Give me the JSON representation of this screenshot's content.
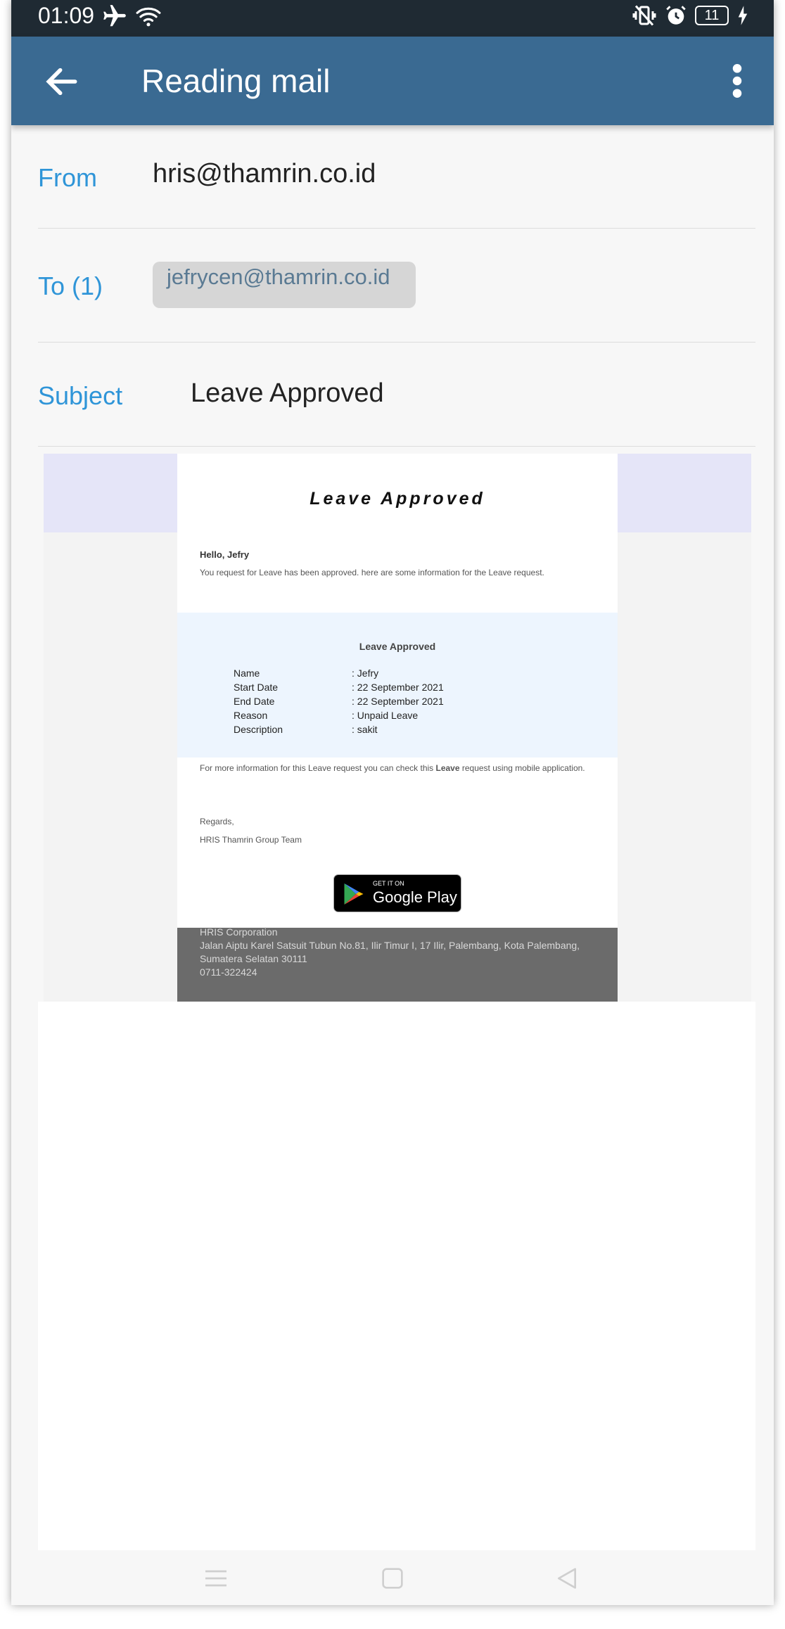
{
  "status_bar": {
    "time": "01:09",
    "battery": "11",
    "icons": [
      "airplane-icon",
      "wifi-icon",
      "vibrate-icon",
      "alarm-icon",
      "battery-icon",
      "charging-icon"
    ]
  },
  "app_bar": {
    "title": "Reading mail",
    "back_icon": "back-arrow-icon",
    "menu_icon": "more-vert-icon"
  },
  "mail": {
    "from_label": "From",
    "from_value": "hris@thamrin.co.id",
    "to_label": "To (1)",
    "to_chip": "jefrycen@thamrin.co.id",
    "subject_label": "Subject",
    "subject_value": "Leave Approved"
  },
  "email_body": {
    "heading": "Leave Approved",
    "greeting": "Hello, Jefry",
    "intro": "You request for Leave has been approved. here are some information for the Leave request.",
    "details_title": "Leave Approved",
    "details": [
      {
        "label": "Name",
        "value": ": Jefry"
      },
      {
        "label": "Start Date",
        "value": ": 22 September 2021"
      },
      {
        "label": "End Date",
        "value": ": 22 September 2021"
      },
      {
        "label": "Reason",
        "value": ": Unpaid Leave"
      },
      {
        "label": "Description",
        "value": ": sakit"
      }
    ],
    "more_info_before": "For more information for this Leave request you can check this ",
    "more_info_bold": "Leave",
    "more_info_after": " request using mobile application.",
    "regards": "Regards,",
    "team": "HRIS Thamrin Group Team",
    "gplay_small": "GET IT ON",
    "gplay_large": "Google Play",
    "footer": {
      "company": "HRIS Corporation",
      "address1": "Jalan Aiptu Karel Satsuit Tubun No.81, Ilir Timur I, 17 Ilir, Palembang, Kota Palembang,",
      "address2": "Sumatera Selatan 30111",
      "phone": "0711-322424"
    }
  },
  "nav_bar": {
    "icons": [
      "recents-icon",
      "home-icon",
      "back-nav-icon"
    ]
  },
  "colors": {
    "app_bar": "#3a6a92",
    "status_bar": "#1f2a33",
    "label_blue": "#2f95d8",
    "chip_bg": "#d6d6d6",
    "details_bg": "#edf5fe",
    "footer_bg": "#6b6b6b"
  }
}
